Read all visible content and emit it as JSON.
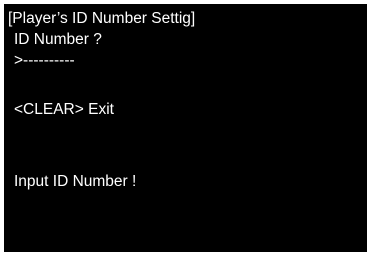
{
  "screen": {
    "title": "[Player’s ID Number Settig]",
    "prompt": "ID Number ?",
    "input_value": ">----------",
    "clear_key_label": "<CLEAR>",
    "clear_action_label": "Exit",
    "status_message": "Input ID Number !"
  },
  "colors": {
    "background": "#000000",
    "text": "#ffffff"
  }
}
